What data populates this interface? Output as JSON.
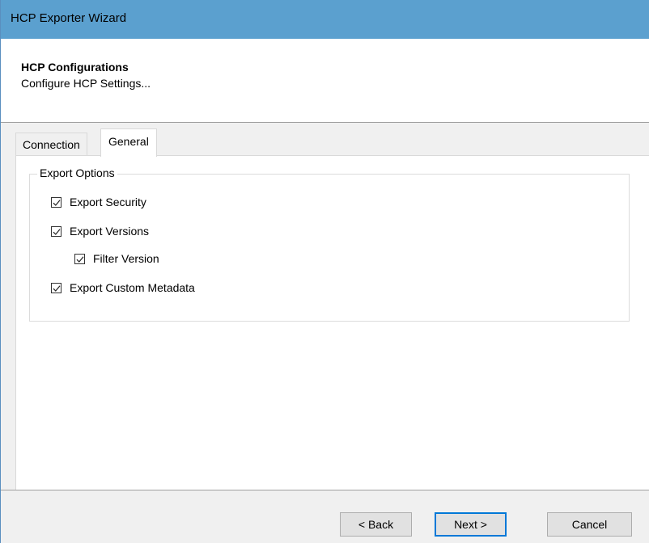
{
  "window": {
    "title": "HCP Exporter Wizard"
  },
  "header": {
    "title": "HCP Configurations",
    "subtitle": "Configure HCP Settings..."
  },
  "tabs": [
    {
      "label": "Connection",
      "active": false
    },
    {
      "label": "General",
      "active": true
    }
  ],
  "export_options": {
    "group_label": "Export Options",
    "items": [
      {
        "label": "Export Security",
        "checked": true
      },
      {
        "label": "Export Versions",
        "checked": true
      },
      {
        "label": "Filter Version",
        "checked": true
      },
      {
        "label": "Export Custom Metadata",
        "checked": true
      }
    ]
  },
  "footer": {
    "back_label": "< Back",
    "next_label": "Next >",
    "cancel_label": "Cancel"
  },
  "colors": {
    "titlebar": "#5ba0cf",
    "default_button_border": "#0078d7"
  },
  "icons": {
    "checkbox_mark": "checkmark-icon"
  }
}
